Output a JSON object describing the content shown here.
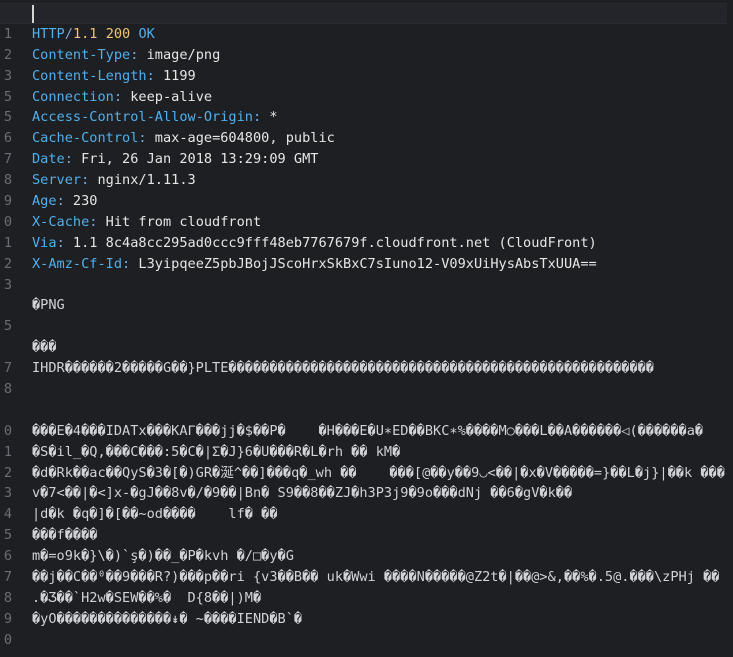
{
  "editor": {
    "line_numbers": [
      "",
      "1",
      "2",
      "3",
      "5",
      "5",
      "6",
      "7",
      "8",
      "9",
      "0",
      "1",
      "2",
      "3",
      "",
      "5",
      "",
      "7",
      "8",
      "",
      "0",
      "1",
      "2",
      "3",
      "4",
      "5",
      "6",
      "7",
      "8",
      "9",
      "0"
    ],
    "status_line": {
      "protocol": "HTTP",
      "slash": "/",
      "version": "1.1",
      "code": "200",
      "reason": "OK"
    },
    "headers": [
      {
        "key": "Content-Type",
        "value": " image/png"
      },
      {
        "key": "Content-Length",
        "value": " 1199"
      },
      {
        "key": "Connection",
        "value": " keep-alive"
      },
      {
        "key": "Access-Control-Allow-Origin",
        "value": " *"
      },
      {
        "key": "Cache-Control",
        "value": " max-age=604800, public"
      },
      {
        "key": "Date",
        "value": " Fri, 26 Jan 2018 13:29:09 GMT"
      },
      {
        "key": "Server",
        "value": " nginx/1.11.3"
      },
      {
        "key": "Age",
        "value": " 230"
      },
      {
        "key": "X-Cache",
        "value": " Hit from cloudfront"
      },
      {
        "key": "Via",
        "value": " 1.1 8c4a8cc295ad0ccc9fff48eb7767679f.cloudfront.net (CloudFront)"
      },
      {
        "key": "X-Amz-Cf-Id",
        "value": " L3yipqeeZ5pbJBojJScoHrxSkBxC7sIuno12-V09xUiHysAbsTxUUA=="
      }
    ],
    "body_lines": [
      "",
      "�PNG",
      "",
      "���",
      "IHDR������2�����G��}PLTE����������������������������������������������������",
      "",
      "",
      "���E�4���IDATx���KAΓ���jj�$��P�    �H���E�U∗ED��BKC∗%����M○���L��A������◁(������a�",
      "�S�il_�Q,���C���:5�C�|Σ�J}6�U���R�L�rh �� kM�",
      "�d�Rk��ac��QyS�3�[�)GR�涎^��]���q�_wh ��    ���[@��y��9◡<��|�x�V�����=}��L�j}|��k ���",
      "v�7<��|�<]x-�gJ��8v�/�9��|Bn� S9��8��ZJ�h3P3j9�9o���dNj ��6�gV�k��",
      "|d�k �q�]�[��~od����    lf� ��",
      "���f����",
      "m�=o9k�}\\�)`ş�)��_�P�kvh �/□�y�G",
      "��j��C��⁰��9���R?)���p��ri {v3��B�� uk�Wwi ����N�����@Z2t�|��@>&,��%�.5@.���\\zPHj ��",
      ".�Ʒ��`H2w�SEW��%�  D{8��|)M�",
      "�yO��������������↡� ~����IEND�B`�"
    ]
  }
}
